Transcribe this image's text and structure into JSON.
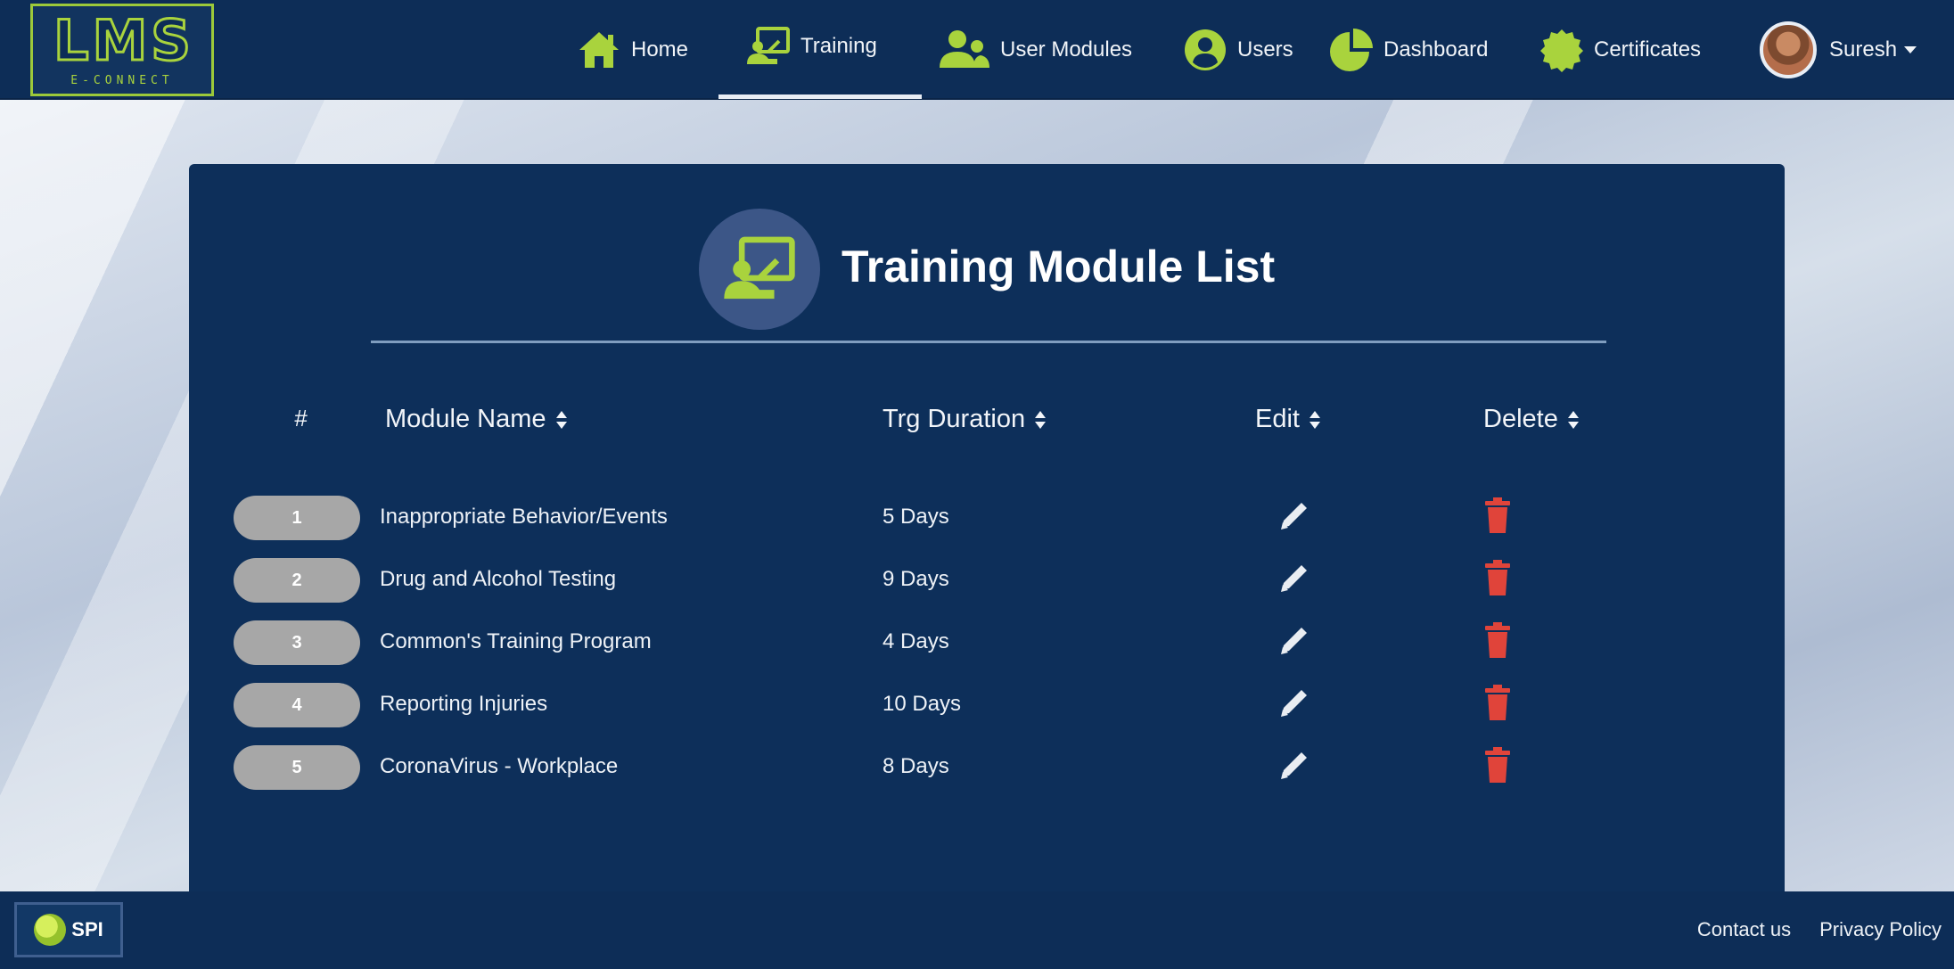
{
  "app": {
    "logo_main": "LMS",
    "logo_sub": "E-CONNECT"
  },
  "nav": {
    "items": [
      {
        "label": "Home",
        "icon": "home-icon"
      },
      {
        "label": "Training",
        "icon": "training-icon",
        "active": true
      },
      {
        "label": "User Modules",
        "icon": "users-icon"
      },
      {
        "label": "Users",
        "icon": "user-circle-icon"
      },
      {
        "label": "Dashboard",
        "icon": "pie-chart-icon"
      },
      {
        "label": "Certificates",
        "icon": "certificate-icon"
      }
    ],
    "user_name": "Suresh"
  },
  "panel": {
    "title": "Training Module List",
    "columns": {
      "index": "#",
      "module_name": "Module Name",
      "duration": "Trg Duration",
      "edit": "Edit",
      "delete": "Delete"
    },
    "rows": [
      {
        "index": "1",
        "module_name": "Inappropriate Behavior/Events",
        "duration": "5 Days"
      },
      {
        "index": "2",
        "module_name": "Drug and Alcohol Testing",
        "duration": "9 Days"
      },
      {
        "index": "3",
        "module_name": "Common's Training Program",
        "duration": "4 Days"
      },
      {
        "index": "4",
        "module_name": "Reporting Injuries",
        "duration": "10 Days"
      },
      {
        "index": "5",
        "module_name": "CoronaVirus - Workplace",
        "duration": "8 Days"
      }
    ]
  },
  "footer": {
    "logo_text": "SPI",
    "links": [
      "Contact us",
      "Privacy Policy"
    ]
  },
  "colors": {
    "navy": "#0d2d57",
    "panel": "#0d2f5a",
    "accent_green": "#a9d33d",
    "delete_red": "#e0443a",
    "pill_grey": "#a7a7a7"
  }
}
